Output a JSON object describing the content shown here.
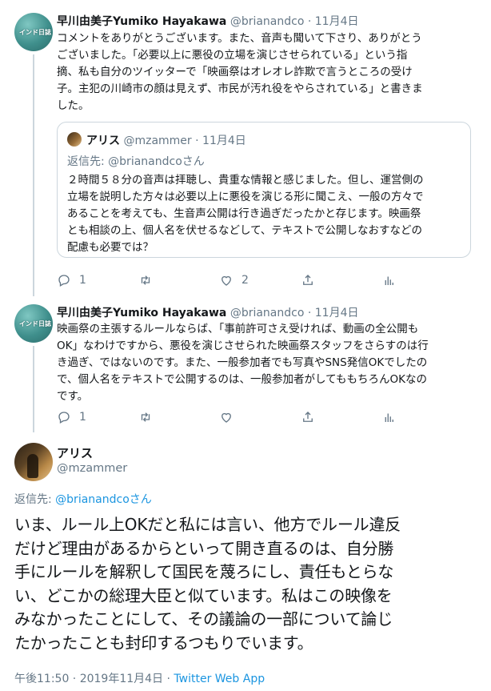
{
  "tweet1": {
    "avatar_text": "インド日誌",
    "name": "早川由美子Yumiko Hayakawa",
    "handle": "@brianandco",
    "dot": "·",
    "time": "11月4日",
    "lines": [
      "コメントをありがとうございます。また、音声も聞いて下さり、ありがとう",
      "ございました。「必要以上に悪役の立場を演じさせられている」という指",
      "摘、私も自分のツイッターで「映画祭はオレオレ詐欺で言うところの受け",
      "子。主犯の川崎市の顔は見えず、市民が汚れ役をやらされている」と書きま",
      "した。"
    ],
    "quote": {
      "name": "アリス",
      "handle": "@mzammer",
      "dot": "·",
      "time": "11月4日",
      "reply_prefix": "返信先: ",
      "reply_user": "@brianandcoさん",
      "lines": [
        "２時間５８分の音声は拝聴し、貴重な情報と感じました。但し、運営側の",
        "立場を説明した方々は必要以上に悪役を演じる形に聞こえ、一般の方々で",
        "あることを考えても、生音声公開は行き過ぎだったかと存じます。映画祭",
        "とも相談の上、個人名を伏せるなどして、テキストで公開しなおすなどの",
        "配慮も必要では？"
      ]
    },
    "actions": {
      "reply_count": "1",
      "retweet_count": "",
      "like_count": "2"
    }
  },
  "tweet2": {
    "avatar_text": "インド日誌",
    "name": "早川由美子Yumiko Hayakawa",
    "handle": "@brianandco",
    "dot": "·",
    "time": "11月4日",
    "lines": [
      "映画祭の主張するルールならば、「事前許可さえ受ければ、動画の全公開も",
      "OK」なわけですから、悪役を演じさせられた映画祭スタッフをさらすのは行",
      "き過ぎ、ではないのです。また、一般参加者でも写真やSNS発信OKでしたの",
      "で、個人名をテキストで公開するのは、一般参加者がしてももちろんOKなの",
      "です。"
    ],
    "actions": {
      "reply_count": "1",
      "retweet_count": "",
      "like_count": ""
    }
  },
  "main": {
    "name": "アリス",
    "handle": "@mzammer",
    "reply_prefix": "返信先: ",
    "reply_user": "@brianandcoさん",
    "lines": [
      "いま、ルール上OKだと私には言い、他方でルール違反",
      "だけど理由があるからといって開き直るのは、自分勝",
      "手にルールを解釈して国民を蔑ろにし、責任もとらな",
      "い、どこかの総理大臣と似ています。私はこの映像を",
      "みなかったことにして、その議論の一部について論じ",
      "たかったことも封印するつもりでいます。"
    ],
    "timestamp": "午後11:50 · 2019年11月4日 · ",
    "source": "Twitter Web App"
  },
  "colors": {
    "link": "#1b95e0",
    "muted": "#657786",
    "border": "#ccd6dd"
  },
  "icons": [
    "reply-icon",
    "retweet-icon",
    "like-icon",
    "share-icon",
    "analytics-icon"
  ]
}
